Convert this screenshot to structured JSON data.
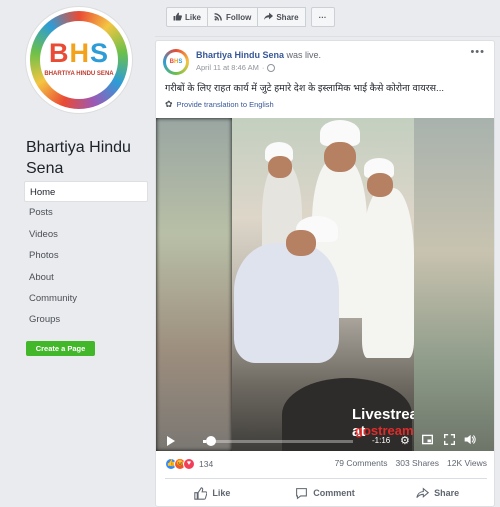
{
  "page": {
    "name": "Bhartiya Hindu Sena",
    "logo": {
      "letters_b": "B",
      "letters_h": "H",
      "letters_s": "S",
      "subtitle": "BHARTIYA HINDU SENA"
    },
    "nav": [
      {
        "label": "Home",
        "active": true
      },
      {
        "label": "Posts"
      },
      {
        "label": "Videos"
      },
      {
        "label": "Photos"
      },
      {
        "label": "About"
      },
      {
        "label": "Community"
      },
      {
        "label": "Groups"
      }
    ],
    "create_page_label": "Create a Page"
  },
  "topbar": {
    "like_label": "Like",
    "follow_label": "Follow",
    "share_label": "Share",
    "more_label": "···"
  },
  "post": {
    "author": "Bhartiya Hindu Sena",
    "action": "was live.",
    "timestamp": "April 11 at 8:46 AM",
    "separator": "·",
    "more_label": "•••",
    "text": "गरीबों के लिए राहत कार्य में जुटे हमारे देश के इस्लामिक भाई कैसे कोरोना वायरस...",
    "translate_label": "Provide translation to English",
    "video": {
      "watermark_line1": "Livestream at",
      "watermark_line2": "gostream.co",
      "time_remaining": "-1:16",
      "progress": 0.02
    },
    "stats": {
      "reactions_count": "134",
      "comments": "79 Comments",
      "shares": "303 Shares",
      "views": "12K Views"
    },
    "actions": {
      "like": "Like",
      "comment": "Comment",
      "share": "Share"
    }
  },
  "colors": {
    "link": "#385898",
    "create_button": "#42b72a",
    "background": "#e9ebee"
  }
}
